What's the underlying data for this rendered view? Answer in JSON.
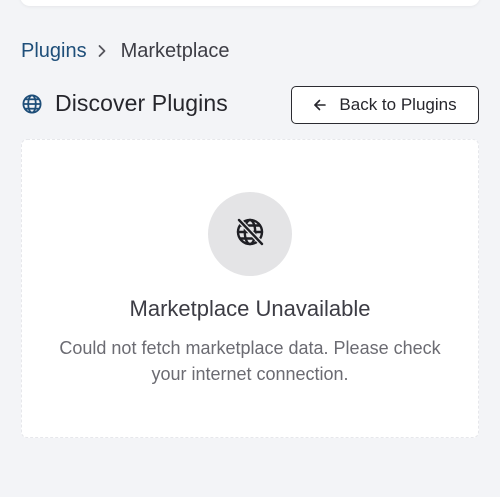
{
  "breadcrumb": {
    "parent": "Plugins",
    "current": "Marketplace"
  },
  "header": {
    "title": "Discover Plugins",
    "back_button_label": "Back to Plugins"
  },
  "empty_state": {
    "title": "Marketplace Unavailable",
    "message": "Could not fetch marketplace data. Please check your internet connection."
  },
  "icons": {
    "header": "globe-icon",
    "empty_state": "globe-off-icon",
    "breadcrumb_separator": "chevron-right-icon",
    "back": "arrow-left-icon"
  },
  "colors": {
    "link": "#1e4e79",
    "background": "#f3f4f7"
  }
}
